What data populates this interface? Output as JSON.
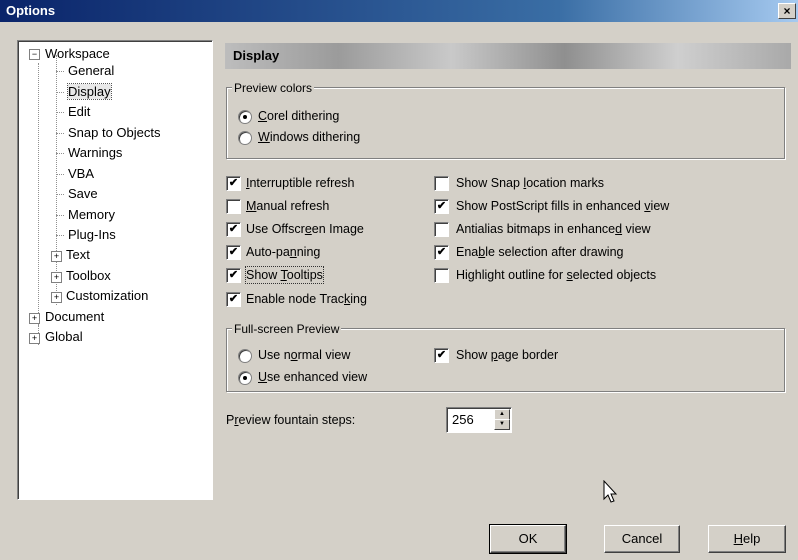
{
  "window": {
    "title": "Options",
    "close_glyph": "×"
  },
  "tree": {
    "workspace": "Workspace",
    "children": [
      "General",
      "Display",
      "Edit",
      "Snap to Objects",
      "Warnings",
      "VBA",
      "Save",
      "Memory",
      "Plug-Ins"
    ],
    "collapsed_children": [
      "Text",
      "Toolbox",
      "Customization"
    ],
    "roots": [
      "Document",
      "Global"
    ],
    "selected": "Display"
  },
  "panel": {
    "title": "Display",
    "preview_colors": {
      "label": "Preview colors",
      "options": [
        {
          "pre": "",
          "key": "C",
          "post": "orel dithering",
          "selected": true
        },
        {
          "pre": "",
          "key": "W",
          "post": "indows dithering",
          "selected": false
        }
      ]
    },
    "checkboxes_left": [
      {
        "pre": "",
        "key": "I",
        "post": "nterruptible refresh",
        "checked": true
      },
      {
        "pre": "",
        "key": "M",
        "post": "anual refresh",
        "checked": false
      },
      {
        "pre": "Use Offscr",
        "key": "e",
        "post": "en Image",
        "checked": true
      },
      {
        "pre": "Auto-pa",
        "key": "n",
        "post": "ning",
        "checked": true
      },
      {
        "pre": "Show ",
        "key": "T",
        "post": "ooltips",
        "checked": true
      },
      {
        "pre": "Enable node Trac",
        "key": "k",
        "post": "ing",
        "checked": true
      }
    ],
    "checkboxes_right": [
      {
        "pre": "Show Snap ",
        "key": "l",
        "post": "ocation marks",
        "checked": false
      },
      {
        "pre": "Show PostScript fills in enhanced ",
        "key": "v",
        "post": "iew",
        "checked": true
      },
      {
        "pre": "Antialias bitmaps in enhance",
        "key": "d",
        "post": " view",
        "checked": false
      },
      {
        "pre": "Ena",
        "key": "b",
        "post": "le selection after drawing",
        "checked": true
      },
      {
        "pre": "Highlight outline for ",
        "key": "s",
        "post": "elected objects",
        "checked": false
      }
    ],
    "fullscreen": {
      "label": "Full-screen Preview",
      "options": [
        {
          "pre": "Use n",
          "key": "o",
          "post": "rmal view",
          "selected": false
        },
        {
          "pre": "",
          "key": "U",
          "post": "se enhanced view",
          "selected": true
        }
      ],
      "page_border": {
        "pre": "Show ",
        "key": "p",
        "post": "age border",
        "checked": true
      }
    },
    "fountain_steps": {
      "pre": "P",
      "key": "r",
      "post": "eview fountain steps:",
      "value": "256"
    }
  },
  "buttons": {
    "ok": "OK",
    "cancel": "Cancel",
    "help": {
      "key": "H",
      "post": "elp"
    }
  },
  "glyphs": {
    "check": "✔",
    "expand": "+",
    "collapse": "−",
    "up": "▲",
    "down": "▼"
  }
}
